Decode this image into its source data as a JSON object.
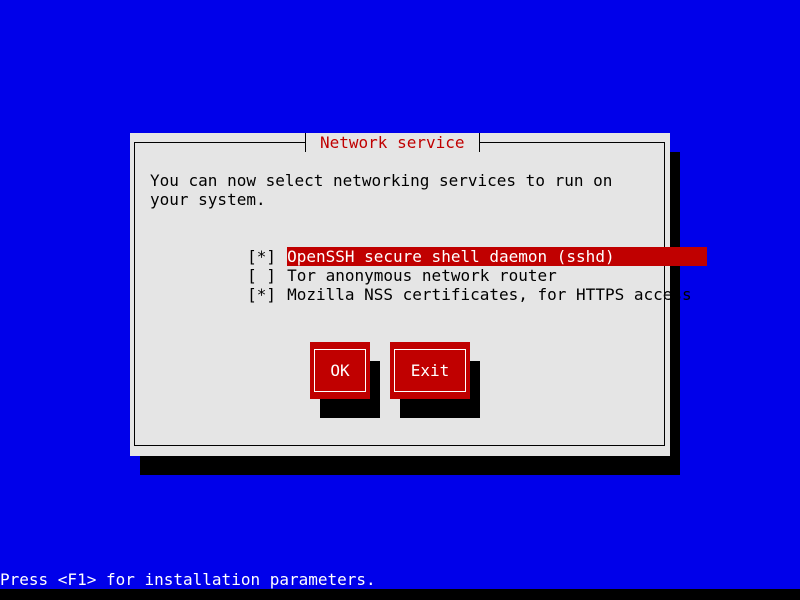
{
  "dialog": {
    "title": "Network service",
    "prompt": "You can now select networking services to run on your system.",
    "options": [
      {
        "check": "[*]",
        "label": "OpenSSH secure shell daemon (sshd)",
        "selected": true
      },
      {
        "check": "[ ]",
        "label": "Tor anonymous network router",
        "selected": false
      },
      {
        "check": "[*]",
        "label": "Mozilla NSS certificates, for HTTPS access",
        "selected": false
      }
    ],
    "buttons": {
      "ok_label": "OK",
      "exit_label": "Exit"
    }
  },
  "status": {
    "hint": "Press <F1> for installation parameters."
  },
  "colors": {
    "background": "#0000ea",
    "dialog": "#e5e5e5",
    "accent": "#c00000",
    "shadow": "#000000"
  }
}
